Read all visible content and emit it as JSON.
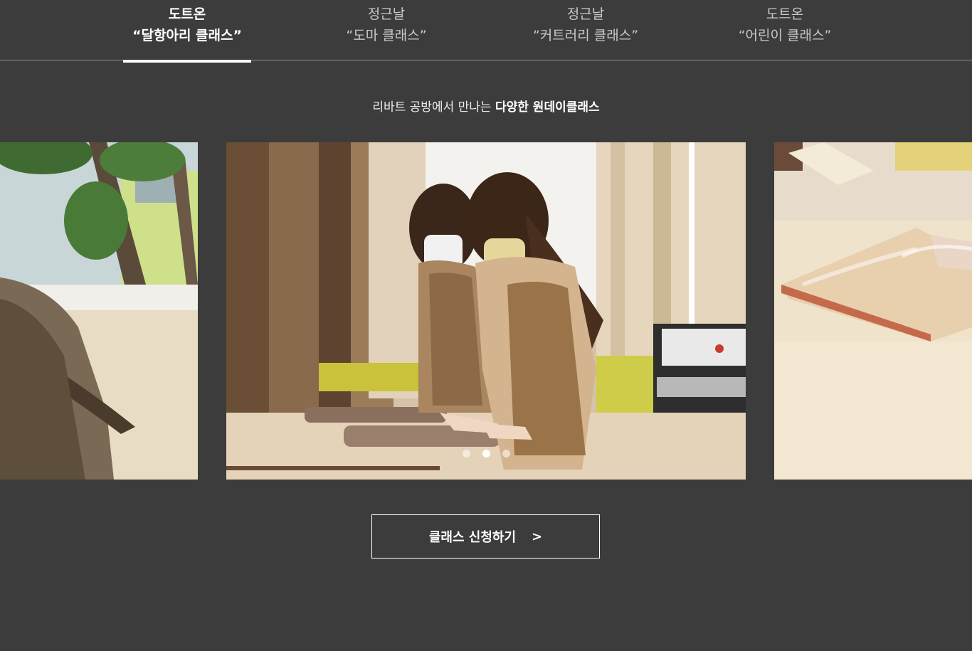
{
  "tabs": [
    {
      "line1": "도트온",
      "line2": "“달항아리 클래스”",
      "active": true
    },
    {
      "line1": "정근날",
      "line2": "“도마 클래스”",
      "active": false
    },
    {
      "line1": "정근날",
      "line2": "“커트러리 클래스”",
      "active": false
    },
    {
      "line1": "도트온",
      "line2": "“어린이 클래스”",
      "active": false
    }
  ],
  "subtitle": {
    "prefix": "리바트 공방에서 만나는 ",
    "emphasis": "다양한 원데이클래스"
  },
  "slider": {
    "slide_count": 3,
    "active_index": 2
  },
  "cta": {
    "label": "클래스 신청하기",
    "arrow": ">"
  },
  "colors": {
    "background": "#3c3c3c",
    "text": "#ffffff",
    "inactive_tab": "#c8c8c8",
    "divider": "#8a8a8a"
  }
}
